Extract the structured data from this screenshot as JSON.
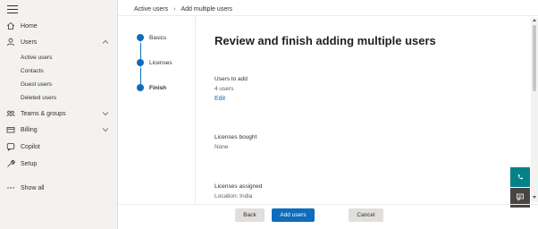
{
  "nav": {
    "items": [
      {
        "label": "Home",
        "icon": "home-icon"
      },
      {
        "label": "Users",
        "icon": "user-icon",
        "expanded": true
      },
      {
        "label": "Teams & groups",
        "icon": "teams-icon"
      },
      {
        "label": "Billing",
        "icon": "billing-icon"
      },
      {
        "label": "Copilot",
        "icon": "copilot-icon"
      },
      {
        "label": "Setup",
        "icon": "wrench-icon"
      },
      {
        "label": "Show all",
        "icon": "ellipsis-icon"
      }
    ],
    "users_sub": [
      "Active users",
      "Contacts",
      "Guest users",
      "Deleted users"
    ]
  },
  "breadcrumb": {
    "parent": "Active users",
    "current": "Add multiple users"
  },
  "stepper": {
    "steps": [
      {
        "label": "Basics",
        "status": "done"
      },
      {
        "label": "Licenses",
        "status": "done"
      },
      {
        "label": "Finish",
        "status": "current"
      }
    ]
  },
  "main": {
    "title": "Review and finish adding multiple users",
    "users_to_add_label": "Users to add",
    "users_to_add_value": "4 users",
    "edit_label": "Edit",
    "licenses_bought_label": "Licenses bought",
    "licenses_bought_value": "None",
    "licenses_assigned_label": "Licenses assigned",
    "licenses_assigned_value": "Location: India"
  },
  "footer": {
    "back_label": "Back",
    "add_label": "Add users",
    "cancel_label": "Cancel"
  },
  "colors": {
    "accent": "#0f6cbd",
    "help_button": "#038387",
    "chat_button": "#484644"
  }
}
